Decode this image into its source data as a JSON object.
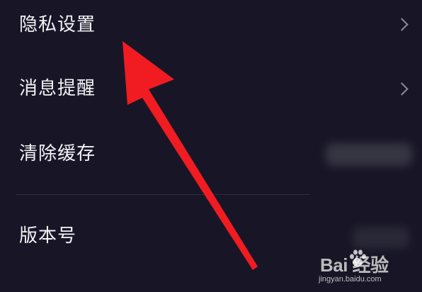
{
  "settings": {
    "items": [
      {
        "label": "隐私设置"
      },
      {
        "label": "消息提醒"
      },
      {
        "label": "清除缓存"
      },
      {
        "label": "版本号"
      }
    ]
  },
  "watermark": {
    "brand": "Bai  经验",
    "url": "jingyan.baidu.com"
  },
  "colors": {
    "background": "#181626",
    "arrow": "#f01c22",
    "text": "#f2f2f5",
    "chevron": "#8c8b98"
  }
}
